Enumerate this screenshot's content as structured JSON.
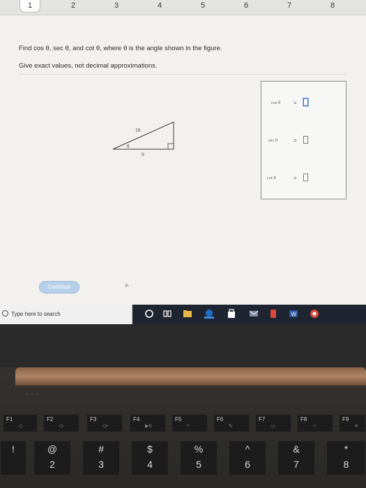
{
  "browser": {
    "tabs": [
      "1",
      "2",
      "3",
      "4",
      "5",
      "6",
      "7",
      "8"
    ],
    "active_tab_index": 0
  },
  "problem": {
    "question": "Find cos θ, sec θ, and cot θ, where θ is the angle shown in the figure.",
    "instruction": "Give exact values, not decimal approximations.",
    "figure": {
      "hypotenuse": "10",
      "adjacent": "9",
      "angle": "θ"
    }
  },
  "answers": {
    "cos_label": "cos θ",
    "sec_label": "sec θ",
    "cot_label": "cot θ",
    "equals": "=",
    "cos_value": "",
    "sec_value": "",
    "cot_value": ""
  },
  "actions": {
    "continue_label": "Continue"
  },
  "taskbar": {
    "search_placeholder": "Type here to search"
  },
  "keyboard": {
    "fkeys": [
      "F1",
      "F2",
      "F3",
      "F4",
      "F5",
      "F6",
      "F7",
      "F8",
      "F9"
    ],
    "number_keys": [
      {
        "top": "!",
        "bottom": ""
      },
      {
        "top": "@",
        "bottom": "2"
      },
      {
        "top": "#",
        "bottom": "3"
      },
      {
        "top": "$",
        "bottom": "4"
      },
      {
        "top": "%",
        "bottom": "5"
      },
      {
        "top": "^",
        "bottom": "6"
      },
      {
        "top": "&",
        "bottom": "7"
      },
      {
        "top": "*",
        "bottom": "8"
      }
    ]
  },
  "colors": {
    "continue_button": "#b8cfe9",
    "taskbar": "#1f2431",
    "hinge": "#b08566"
  }
}
